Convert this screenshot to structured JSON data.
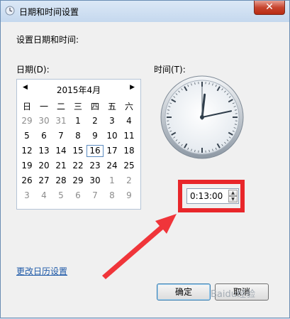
{
  "window": {
    "title": "日期和时间设置",
    "close_label": "✕"
  },
  "main": {
    "heading": "设置日期和时间:",
    "date_label": "日期(D):",
    "time_label": "时间(T):"
  },
  "calendar": {
    "month_title": "2015年4月",
    "prev_icon": "◀",
    "next_icon": "▶",
    "weekdays": [
      "日",
      "一",
      "二",
      "三",
      "四",
      "五",
      "六"
    ],
    "weeks": [
      [
        "29",
        "30",
        "31",
        "1",
        "2",
        "3",
        "4"
      ],
      [
        "5",
        "6",
        "7",
        "8",
        "9",
        "10",
        "11"
      ],
      [
        "12",
        "13",
        "14",
        "15",
        "16",
        "17",
        "18"
      ],
      [
        "19",
        "20",
        "21",
        "22",
        "23",
        "24",
        "25"
      ],
      [
        "26",
        "27",
        "28",
        "29",
        "30",
        "1",
        "2"
      ],
      [
        "3",
        "4",
        "5",
        "6",
        "7",
        "8",
        "9"
      ]
    ],
    "selected_day": "16"
  },
  "time": {
    "value": "0:13:00",
    "hour": 0,
    "minute": 13,
    "second": 0
  },
  "footer": {
    "change_calendar_link": "更改日历设置",
    "ok_label": "确定",
    "cancel_label": "取消",
    "watermark": "Baidu经验"
  },
  "colors": {
    "highlight": "#e8262a",
    "arrow": "#f0353a",
    "link": "#1f5aa8"
  }
}
